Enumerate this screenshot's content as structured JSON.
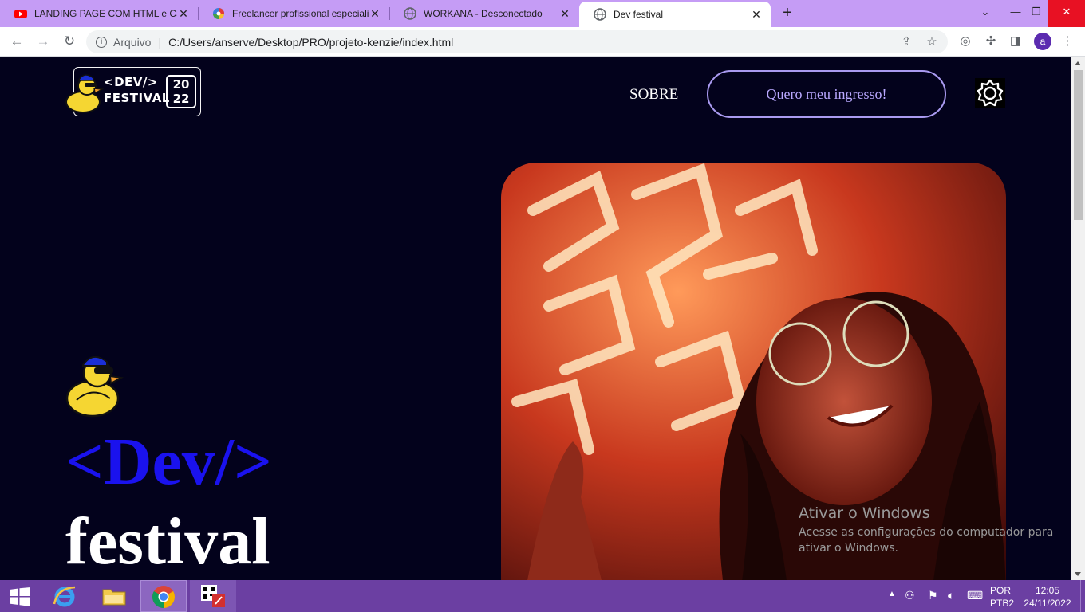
{
  "browser": {
    "tabs": [
      {
        "title": "LANDING PAGE COM HTML e CSS",
        "icon": "youtube-icon",
        "active": false
      },
      {
        "title": "Freelancer profissional especialista",
        "icon": "colorwheel-icon",
        "active": false
      },
      {
        "title": "WORKANA - Desconectado",
        "icon": "globe-icon",
        "active": false
      },
      {
        "title": "Dev festival",
        "icon": "globe-icon",
        "active": true
      }
    ],
    "address": {
      "scheme_label": "Arquivo",
      "url": "C:/Users/anserve/Desktop/PRO/projeto-kenzie/index.html"
    },
    "profile_initial": "a"
  },
  "page": {
    "logo": {
      "line1": "<DEV/>",
      "line2": "FESTIVAL",
      "year_top": "20",
      "year_bottom": "22"
    },
    "nav": {
      "sobre": "SOBRE",
      "cta": "Quero meu ingresso!"
    },
    "hero": {
      "title_line1": "<Dev/>",
      "title_line2": "festival"
    }
  },
  "watermark": {
    "title": "Ativar o Windows",
    "line1": "Acesse as configurações do computador para",
    "line2": "ativar o Windows."
  },
  "taskbar": {
    "lang_top": "POR",
    "lang_bottom": "PTB2",
    "time": "12:05",
    "date": "24/11/2022"
  },
  "colors": {
    "page_bg": "#03021c",
    "tabstrip": "#c59cf5",
    "cta_border": "#a99af0",
    "title_blue": "#1a12ee",
    "taskbar": "#6b3fa2"
  }
}
